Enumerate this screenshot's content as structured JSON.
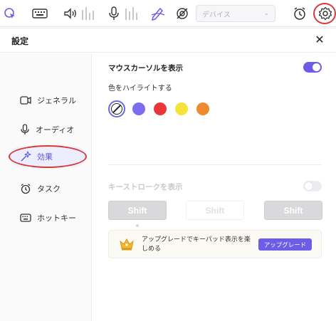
{
  "toolbar": {
    "icons": [
      "cursor-capture-icon",
      "keyboard-icon",
      "speaker-icon",
      "microphone-icon",
      "pen-icon",
      "camera-off-icon",
      "alarm-clock-icon",
      "gear-icon"
    ],
    "device_placeholder": "デバイス",
    "accent": "#6c5ce7",
    "annotation_color": "#d93a3a"
  },
  "dialog": {
    "title": "設定",
    "close": "✕"
  },
  "sidebar": {
    "items": [
      {
        "label": "ジェネラル",
        "icon": "video-camera-icon",
        "active": false
      },
      {
        "label": "オーディオ",
        "icon": "microphone-icon",
        "active": false
      },
      {
        "label": "効果",
        "icon": "magic-wand-icon",
        "active": true
      },
      {
        "label": "タスク",
        "icon": "alarm-clock-icon",
        "active": false
      },
      {
        "label": "ホットキー",
        "icon": "keyboard-icon",
        "active": false
      }
    ]
  },
  "effects": {
    "cursor_title": "マウスカーソルを表示",
    "cursor_enabled": true,
    "highlight_label": "色をハイライトする",
    "highlight_colors": [
      "#7b6cf0",
      "#e8363a",
      "#f5e23a",
      "#f08a2e"
    ],
    "keystroke_title": "キーストロークを表示",
    "keystroke_enabled": false,
    "keys": [
      "Shift",
      "Shift",
      "Shift"
    ],
    "upgrade_text": "アップグレードでキーパッド表示を楽しめる",
    "upgrade_button": "アップグレード"
  }
}
